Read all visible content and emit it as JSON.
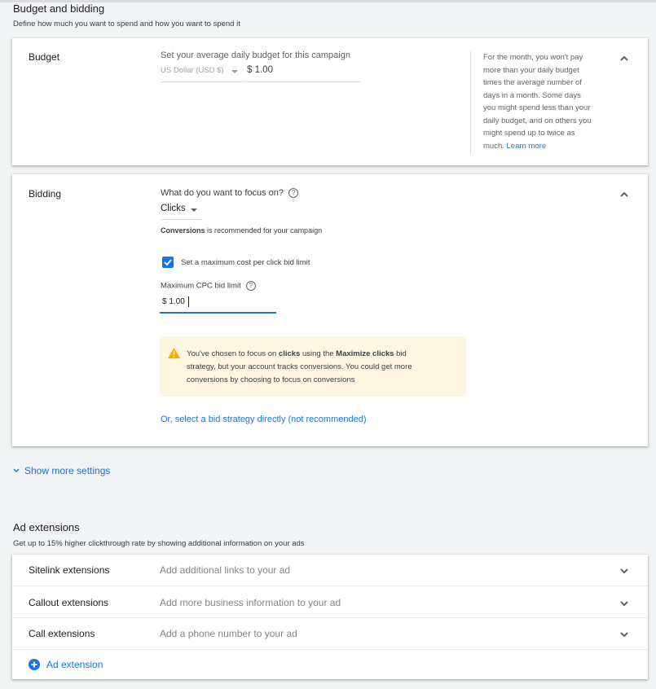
{
  "budget_bidding": {
    "title": "Budget and bidding",
    "subtitle": "Define how much you want to spend and how you want to spend it"
  },
  "budget": {
    "label": "Budget",
    "prompt": "Set your average daily budget for this campaign",
    "currency_select": "US Dollar (USD $)",
    "amount_value": "$ 1.00",
    "help_lines": [
      "For the month, you won't pay",
      "more than your daily budget",
      "times the average number of",
      "days in a month. Some days",
      "you might spend less than your",
      "daily budget, and on others you",
      "might spend up to twice as",
      "much."
    ],
    "learn_more": "Learn more"
  },
  "bidding": {
    "label": "Bidding",
    "focus_question": "What do you want to focus on?",
    "focus_value": "Clicks",
    "recommendation_bold": "Conversions",
    "recommendation_rest": " is recommended for your campaign",
    "max_cpc_checkbox_label": "Set a maximum cost per click bid limit",
    "max_cpc_checked": true,
    "max_cpc_label": "Maximum CPC bid limit",
    "max_cpc_value": "$ 1.00",
    "warning": {
      "p1": "You've chosen to focus on ",
      "b1": "clicks",
      "p2": " using the ",
      "b2": "Maximize clicks",
      "p3": " bid",
      "line2": "strategy, but your account tracks conversions. You could get more",
      "line3": "conversions by choosing to focus on conversions"
    },
    "strategy_link": "Or, select a bid strategy directly (not recommended)"
  },
  "show_more": "Show more settings",
  "ad_extensions": {
    "title": "Ad extensions",
    "subtitle": "Get up to 15% higher clickthrough rate by showing additional information on your ads",
    "rows": [
      {
        "label": "Sitelink extensions",
        "desc": "Add additional links to your ad"
      },
      {
        "label": "Callout extensions",
        "desc": "Add more business information to your ad"
      },
      {
        "label": "Call extensions",
        "desc": "Add a phone number to your ad"
      }
    ],
    "add_label": "Ad extension"
  },
  "colors": {
    "accent": "#1a73e8",
    "warning_bg": "#fef7e0",
    "warning_icon": "#f9ab00"
  }
}
